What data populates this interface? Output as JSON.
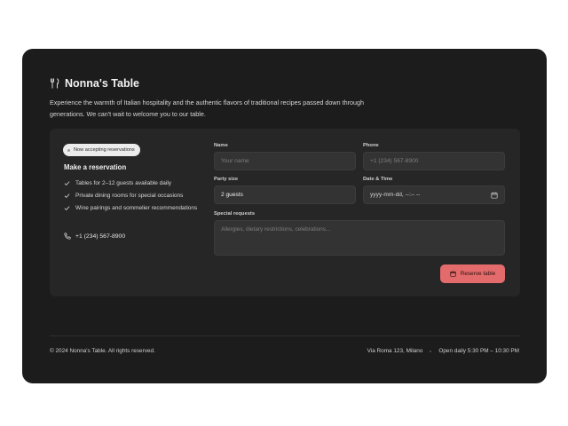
{
  "brand": {
    "title": "Nonna's Table",
    "icon": "fork-knife-icon"
  },
  "intro": "Experience the warmth of Italian hospitality and the authentic flavors of traditional recipes passed down through generations. We can't wait to welcome you to our table.",
  "reservation": {
    "badge": "Now accepting reservations",
    "title": "Make a reservation",
    "features": [
      "Tables for 2–12 guests available daily",
      "Private dining rooms for special occasions",
      "Wine pairings and sommelier recommendations"
    ],
    "phone": "+1 (234) 567-8900"
  },
  "form": {
    "name_label": "Name",
    "name_placeholder": "Your name",
    "phone_label": "Phone",
    "phone_placeholder": "+1 (234) 567-8900",
    "party_label": "Party size",
    "party_value": "2 guests",
    "datetime_label": "Date & Time",
    "datetime_value": "yyyy-mm-dd, --:-- --",
    "requests_label": "Special requests",
    "requests_placeholder": "Allergies, dietary restrictions, celebrations...",
    "submit_label": "Reserve table"
  },
  "footer": {
    "copyright": "© 2024 Nonna's Table. All rights reserved.",
    "address": "Via Roma 123, Milano",
    "hours": "Open daily 5:30 PM – 10:30 PM"
  },
  "colors": {
    "card": "#1c1c1c",
    "panel": "#262626",
    "accent": "#e46b6b"
  }
}
